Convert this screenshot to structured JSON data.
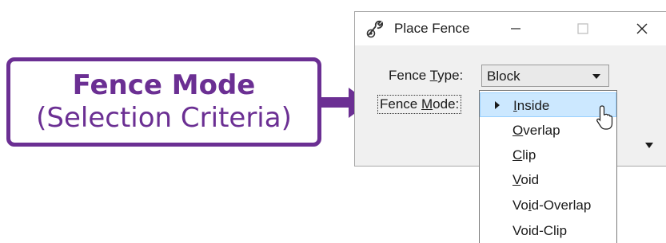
{
  "callout": {
    "title": "Fence Mode",
    "subtitle": "(Selection Criteria)",
    "color": "#6b2f93"
  },
  "dialog": {
    "title": "Place Fence",
    "icon": "wrench-gear-icon",
    "controls": {
      "minimize": "—",
      "maximize": "☐",
      "close": "✕"
    },
    "fence_type": {
      "label_before": "Fence ",
      "label_accel": "T",
      "label_after": "ype:",
      "value": "Block"
    },
    "fence_mode": {
      "label_before": "Fence ",
      "label_accel": "M",
      "label_after": "ode:"
    }
  },
  "dropdown": {
    "highlight_color": "#cce8ff",
    "options": [
      {
        "before": "",
        "accel": "I",
        "after": "nside",
        "selected": true
      },
      {
        "before": "",
        "accel": "O",
        "after": "verlap",
        "selected": false
      },
      {
        "before": "",
        "accel": "C",
        "after": "lip",
        "selected": false
      },
      {
        "before": "",
        "accel": "V",
        "after": "oid",
        "selected": false
      },
      {
        "before": "Vo",
        "accel": "i",
        "after": "d-Overlap",
        "selected": false
      },
      {
        "before": "Void-Clip",
        "accel": "",
        "after": "",
        "selected": false
      }
    ]
  }
}
